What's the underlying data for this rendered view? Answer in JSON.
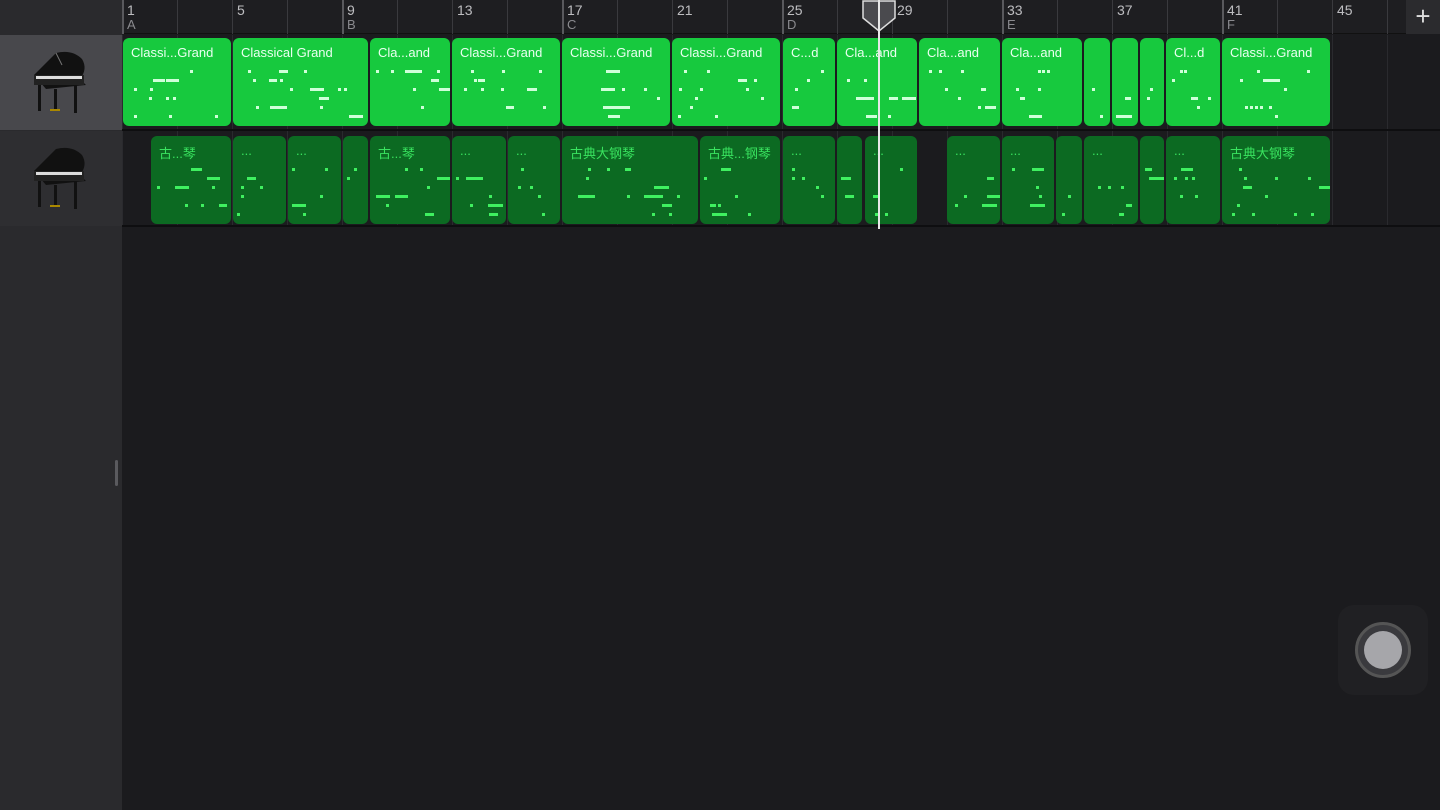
{
  "ruler": {
    "bars": [
      "1",
      "5",
      "9",
      "13",
      "17",
      "21",
      "25",
      "29",
      "33",
      "37",
      "41",
      "45"
    ],
    "sections": [
      {
        "bar": "1",
        "label": "A"
      },
      {
        "bar": "9",
        "label": "B"
      },
      {
        "bar": "17",
        "label": "C"
      },
      {
        "bar": "25",
        "label": "D"
      },
      {
        "bar": "33",
        "label": "E"
      },
      {
        "bar": "41",
        "label": "F"
      }
    ],
    "add_label": "+"
  },
  "tracks": [
    {
      "instrument_icon": "grand-piano-icon",
      "selected": true,
      "regions": [
        "Classi...Grand",
        "Classical Grand",
        "Cla...and",
        "Classi...Grand",
        "Classi...Grand",
        "Classi...Grand",
        "C...d",
        "Cla...and",
        "Cla...and",
        "Cla...and",
        "",
        "",
        "",
        "Cl...d",
        "Classi...Grand"
      ]
    },
    {
      "instrument_icon": "grand-piano-icon",
      "selected": false,
      "regions": [
        "古...琴",
        "...",
        "...",
        "",
        "古...琴",
        "...",
        "...",
        "古典大钢琴",
        "古典...钢琴",
        "...",
        "",
        "...",
        "...",
        "...",
        "",
        "...",
        "",
        "...",
        "古典大钢琴"
      ]
    }
  ],
  "playhead_bar": 28.4,
  "colors": {
    "region_track1": "#17c93e",
    "region_track2": "#0c6a22",
    "background": "#1b1b1e"
  }
}
